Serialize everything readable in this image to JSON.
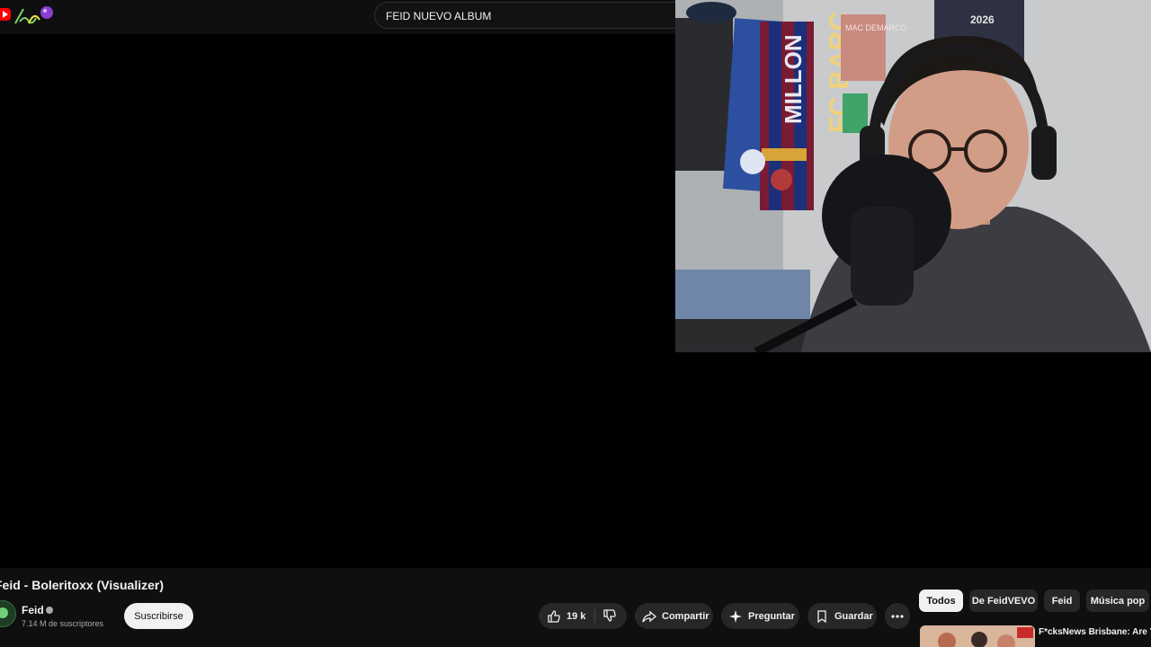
{
  "search": {
    "query": "FEID NUEVO ALBUM"
  },
  "video": {
    "title": "Feid - Boleritoxx (Visualizer)",
    "channel": "Feid",
    "subscribers": "7.14 M de suscriptores",
    "subscribe_label": "Suscribirse",
    "likes": "19 k",
    "share_label": "Compartir",
    "ask_label": "Preguntar",
    "save_label": "Guardar"
  },
  "webcam": {
    "scarf_text_1": "MILLON",
    "scarf_text_2": "FC BARC",
    "poster_text": "MAC DEMARCO",
    "poster2_text": "2026"
  },
  "related": {
    "chips": [
      "Todos",
      "De FeidVEVO",
      "Feid",
      "Música pop"
    ],
    "active_chip": "Todos",
    "first_video_title": "F*cksNews Brisbane: Are You Happy?"
  },
  "icons": {
    "logo": "youtube-logo-icon",
    "doodle": "channel-doodle-icon",
    "like": "thumbs-up-icon",
    "dislike": "thumbs-down-icon",
    "share": "share-arrow-icon",
    "ask": "sparkle-icon",
    "save": "bookmark-icon",
    "more": "more-horizontal-icon",
    "verified": "verified-badge-icon"
  }
}
